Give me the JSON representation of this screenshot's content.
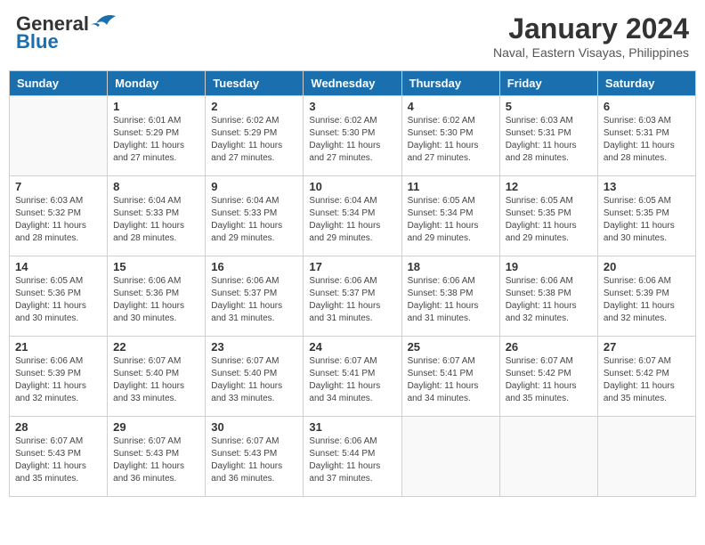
{
  "header": {
    "logo_line1": "General",
    "logo_line2": "Blue",
    "title": "January 2024",
    "subtitle": "Naval, Eastern Visayas, Philippines"
  },
  "weekdays": [
    "Sunday",
    "Monday",
    "Tuesday",
    "Wednesday",
    "Thursday",
    "Friday",
    "Saturday"
  ],
  "weeks": [
    [
      {
        "day": "",
        "sunrise": "",
        "sunset": "",
        "daylight": ""
      },
      {
        "day": "1",
        "sunrise": "Sunrise: 6:01 AM",
        "sunset": "Sunset: 5:29 PM",
        "daylight": "Daylight: 11 hours and 27 minutes."
      },
      {
        "day": "2",
        "sunrise": "Sunrise: 6:02 AM",
        "sunset": "Sunset: 5:29 PM",
        "daylight": "Daylight: 11 hours and 27 minutes."
      },
      {
        "day": "3",
        "sunrise": "Sunrise: 6:02 AM",
        "sunset": "Sunset: 5:30 PM",
        "daylight": "Daylight: 11 hours and 27 minutes."
      },
      {
        "day": "4",
        "sunrise": "Sunrise: 6:02 AM",
        "sunset": "Sunset: 5:30 PM",
        "daylight": "Daylight: 11 hours and 27 minutes."
      },
      {
        "day": "5",
        "sunrise": "Sunrise: 6:03 AM",
        "sunset": "Sunset: 5:31 PM",
        "daylight": "Daylight: 11 hours and 28 minutes."
      },
      {
        "day": "6",
        "sunrise": "Sunrise: 6:03 AM",
        "sunset": "Sunset: 5:31 PM",
        "daylight": "Daylight: 11 hours and 28 minutes."
      }
    ],
    [
      {
        "day": "7",
        "sunrise": "Sunrise: 6:03 AM",
        "sunset": "Sunset: 5:32 PM",
        "daylight": "Daylight: 11 hours and 28 minutes."
      },
      {
        "day": "8",
        "sunrise": "Sunrise: 6:04 AM",
        "sunset": "Sunset: 5:33 PM",
        "daylight": "Daylight: 11 hours and 28 minutes."
      },
      {
        "day": "9",
        "sunrise": "Sunrise: 6:04 AM",
        "sunset": "Sunset: 5:33 PM",
        "daylight": "Daylight: 11 hours and 29 minutes."
      },
      {
        "day": "10",
        "sunrise": "Sunrise: 6:04 AM",
        "sunset": "Sunset: 5:34 PM",
        "daylight": "Daylight: 11 hours and 29 minutes."
      },
      {
        "day": "11",
        "sunrise": "Sunrise: 6:05 AM",
        "sunset": "Sunset: 5:34 PM",
        "daylight": "Daylight: 11 hours and 29 minutes."
      },
      {
        "day": "12",
        "sunrise": "Sunrise: 6:05 AM",
        "sunset": "Sunset: 5:35 PM",
        "daylight": "Daylight: 11 hours and 29 minutes."
      },
      {
        "day": "13",
        "sunrise": "Sunrise: 6:05 AM",
        "sunset": "Sunset: 5:35 PM",
        "daylight": "Daylight: 11 hours and 30 minutes."
      }
    ],
    [
      {
        "day": "14",
        "sunrise": "Sunrise: 6:05 AM",
        "sunset": "Sunset: 5:36 PM",
        "daylight": "Daylight: 11 hours and 30 minutes."
      },
      {
        "day": "15",
        "sunrise": "Sunrise: 6:06 AM",
        "sunset": "Sunset: 5:36 PM",
        "daylight": "Daylight: 11 hours and 30 minutes."
      },
      {
        "day": "16",
        "sunrise": "Sunrise: 6:06 AM",
        "sunset": "Sunset: 5:37 PM",
        "daylight": "Daylight: 11 hours and 31 minutes."
      },
      {
        "day": "17",
        "sunrise": "Sunrise: 6:06 AM",
        "sunset": "Sunset: 5:37 PM",
        "daylight": "Daylight: 11 hours and 31 minutes."
      },
      {
        "day": "18",
        "sunrise": "Sunrise: 6:06 AM",
        "sunset": "Sunset: 5:38 PM",
        "daylight": "Daylight: 11 hours and 31 minutes."
      },
      {
        "day": "19",
        "sunrise": "Sunrise: 6:06 AM",
        "sunset": "Sunset: 5:38 PM",
        "daylight": "Daylight: 11 hours and 32 minutes."
      },
      {
        "day": "20",
        "sunrise": "Sunrise: 6:06 AM",
        "sunset": "Sunset: 5:39 PM",
        "daylight": "Daylight: 11 hours and 32 minutes."
      }
    ],
    [
      {
        "day": "21",
        "sunrise": "Sunrise: 6:06 AM",
        "sunset": "Sunset: 5:39 PM",
        "daylight": "Daylight: 11 hours and 32 minutes."
      },
      {
        "day": "22",
        "sunrise": "Sunrise: 6:07 AM",
        "sunset": "Sunset: 5:40 PM",
        "daylight": "Daylight: 11 hours and 33 minutes."
      },
      {
        "day": "23",
        "sunrise": "Sunrise: 6:07 AM",
        "sunset": "Sunset: 5:40 PM",
        "daylight": "Daylight: 11 hours and 33 minutes."
      },
      {
        "day": "24",
        "sunrise": "Sunrise: 6:07 AM",
        "sunset": "Sunset: 5:41 PM",
        "daylight": "Daylight: 11 hours and 34 minutes."
      },
      {
        "day": "25",
        "sunrise": "Sunrise: 6:07 AM",
        "sunset": "Sunset: 5:41 PM",
        "daylight": "Daylight: 11 hours and 34 minutes."
      },
      {
        "day": "26",
        "sunrise": "Sunrise: 6:07 AM",
        "sunset": "Sunset: 5:42 PM",
        "daylight": "Daylight: 11 hours and 35 minutes."
      },
      {
        "day": "27",
        "sunrise": "Sunrise: 6:07 AM",
        "sunset": "Sunset: 5:42 PM",
        "daylight": "Daylight: 11 hours and 35 minutes."
      }
    ],
    [
      {
        "day": "28",
        "sunrise": "Sunrise: 6:07 AM",
        "sunset": "Sunset: 5:43 PM",
        "daylight": "Daylight: 11 hours and 35 minutes."
      },
      {
        "day": "29",
        "sunrise": "Sunrise: 6:07 AM",
        "sunset": "Sunset: 5:43 PM",
        "daylight": "Daylight: 11 hours and 36 minutes."
      },
      {
        "day": "30",
        "sunrise": "Sunrise: 6:07 AM",
        "sunset": "Sunset: 5:43 PM",
        "daylight": "Daylight: 11 hours and 36 minutes."
      },
      {
        "day": "31",
        "sunrise": "Sunrise: 6:06 AM",
        "sunset": "Sunset: 5:44 PM",
        "daylight": "Daylight: 11 hours and 37 minutes."
      },
      {
        "day": "",
        "sunrise": "",
        "sunset": "",
        "daylight": ""
      },
      {
        "day": "",
        "sunrise": "",
        "sunset": "",
        "daylight": ""
      },
      {
        "day": "",
        "sunrise": "",
        "sunset": "",
        "daylight": ""
      }
    ]
  ]
}
